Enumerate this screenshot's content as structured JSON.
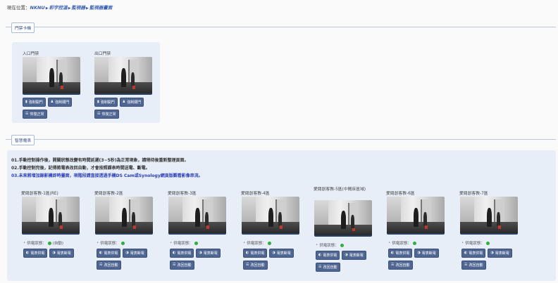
{
  "breadcrumb": {
    "prefix": "現在位置：",
    "items": [
      "NKNU",
      "彩宇控溫",
      "監視器",
      "監視器畫面"
    ],
    "separator": "▶"
  },
  "door_section": {
    "legend": "門禁卡機",
    "cards": [
      {
        "title": "入口門禁",
        "buttons": [
          "強制開門",
          "強制關門",
          "恢復正常"
        ]
      },
      {
        "title": "出口門禁",
        "buttons": [
          "強制開門",
          "強制關門",
          "恢復正常"
        ]
      }
    ]
  },
  "power_section": {
    "legend": "智慧電表",
    "notes": [
      "01.手動控制操作後，開關狀態改變有時間延遲(3~5秒)為正常現象，請稍待後重新整理頁面。",
      "02.手動控制完後，記得將電表改回自動，才會按照課表時間送電、斷電。",
      "03.未來將增加錄影機即時畫面，現階段請直接透過手機DS Cam或Synology網頁版觀看影像串流。"
    ],
    "status_label": "供電狀態：",
    "cards": [
      {
        "title": "愛閱創客教-1區(RE)",
        "status_suffix": "(自動)",
        "buttons": [
          "電表供電",
          "電表斷電"
        ],
        "extra": ""
      },
      {
        "title": "愛閱創客教-2區",
        "status_suffix": "",
        "buttons": [
          "電表供電",
          "電表斷電"
        ],
        "extra": "改回自動"
      },
      {
        "title": "愛閱創客教-3區",
        "status_suffix": "",
        "buttons": [
          "電表供電",
          "電表斷電"
        ],
        "extra": "改回自動"
      },
      {
        "title": "愛閱創客教-4區",
        "status_suffix": "",
        "buttons": [
          "電表供電",
          "電表斷電"
        ],
        "extra": "改回自動"
      },
      {
        "title": "愛閱創客教-5區(中間床區域)",
        "status_suffix": "",
        "buttons": [
          "電表供電",
          "電表斷電"
        ],
        "extra": "改回自動"
      },
      {
        "title": "愛閱創客教-6區",
        "status_suffix": "",
        "buttons": [
          "電表供電",
          "電表斷電"
        ],
        "extra": "改回自動"
      },
      {
        "title": "愛閱創客教-7區",
        "status_suffix": "",
        "buttons": [
          "電表供電",
          "電表斷電"
        ],
        "extra": "改回自動"
      }
    ]
  },
  "colors": {
    "accent": "#4f6592",
    "panel": "#e7eef8",
    "status_on": "#2eae3f"
  }
}
